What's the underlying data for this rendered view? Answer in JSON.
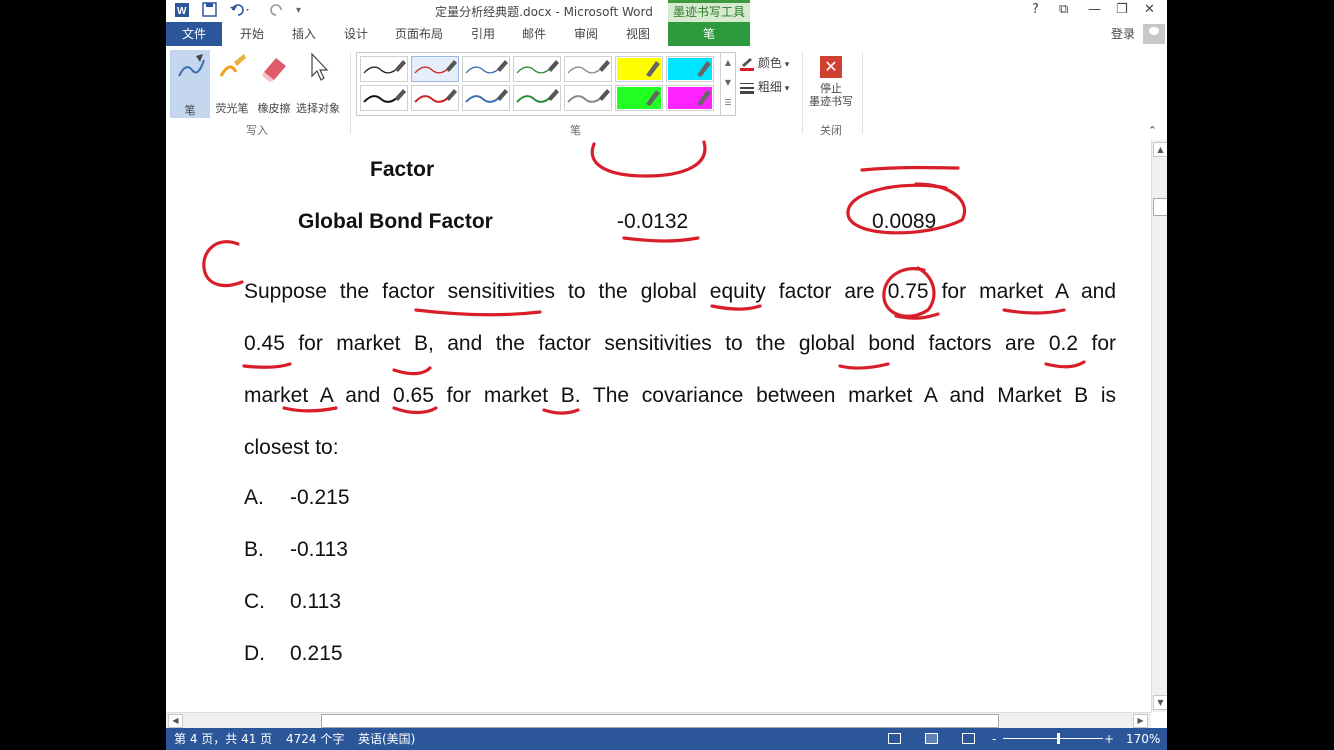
{
  "app": {
    "title": "定量分析经典题.docx - Microsoft Word",
    "contextual_tab_group": "墨迹书写工具",
    "window_buttons": [
      "?",
      "⧉",
      "—",
      "❐",
      "✕"
    ],
    "login": "登录"
  },
  "tabs": {
    "file": "文件",
    "items": [
      "开始",
      "插入",
      "设计",
      "页面布局",
      "引用",
      "邮件",
      "审阅",
      "视图"
    ],
    "active": "笔"
  },
  "ribbon": {
    "write_group": {
      "label": "写入",
      "tools": [
        {
          "label": "笔",
          "icon": "pen-icon"
        },
        {
          "label": "荧光笔",
          "icon": "highlighter-icon"
        },
        {
          "label": "橡皮擦",
          "icon": "eraser-icon"
        },
        {
          "label": "选择对象",
          "icon": "select-cursor-icon"
        }
      ]
    },
    "pens_group": {
      "label": "笔",
      "swatches": [
        {
          "color": "#222222",
          "kind": "pen"
        },
        {
          "color": "#cc2222",
          "kind": "pen",
          "selected": true
        },
        {
          "color": "#3a6fb0",
          "kind": "pen"
        },
        {
          "color": "#2a8a3a",
          "kind": "pen"
        },
        {
          "color": "#888888",
          "kind": "pen"
        },
        {
          "color": "#ffff00",
          "kind": "highlighter"
        },
        {
          "color": "#00e5ff",
          "kind": "highlighter"
        },
        {
          "color": "#111111",
          "kind": "pen"
        },
        {
          "color": "#cc2222",
          "kind": "pen"
        },
        {
          "color": "#3a6fb0",
          "kind": "pen"
        },
        {
          "color": "#2a8a3a",
          "kind": "pen"
        },
        {
          "color": "#888888",
          "kind": "pen"
        },
        {
          "color": "#22ff22",
          "kind": "highlighter"
        },
        {
          "color": "#ff22ff",
          "kind": "highlighter"
        }
      ],
      "color_label": "颜色",
      "weight_label": "粗细"
    },
    "close_group": {
      "label": "关闭",
      "stop_line1": "停止",
      "stop_line2": "墨迹书写"
    }
  },
  "document": {
    "row_factor": "Factor",
    "row_bond": {
      "label": "Global Bond Factor",
      "value_a": "-0.0132",
      "value_b": "0.0089"
    },
    "paragraph_lines": [
      "Suppose the factor sensitivities to the global equity factor are 0.75 for market A and",
      "0.45 for market B, and the factor sensitivities to the global bond factors are 0.2 for",
      "market A and 0.65 for market B. The covariance between market A and Market B is",
      "closest to:"
    ],
    "options": [
      {
        "letter": "A.",
        "value": "-0.215"
      },
      {
        "letter": "B.",
        "value": "-0.113"
      },
      {
        "letter": "C.",
        "value": "0.113"
      },
      {
        "letter": "D.",
        "value": "0.215"
      }
    ],
    "ink_color": "#d81e28"
  },
  "status": {
    "page": "第 4 页，共 41 页",
    "words": "4724 个字",
    "language": "英语(美国)",
    "zoom_minus": "-",
    "zoom_plus": "+",
    "zoom": "170%",
    "zoom_level_fraction": 0.55
  }
}
